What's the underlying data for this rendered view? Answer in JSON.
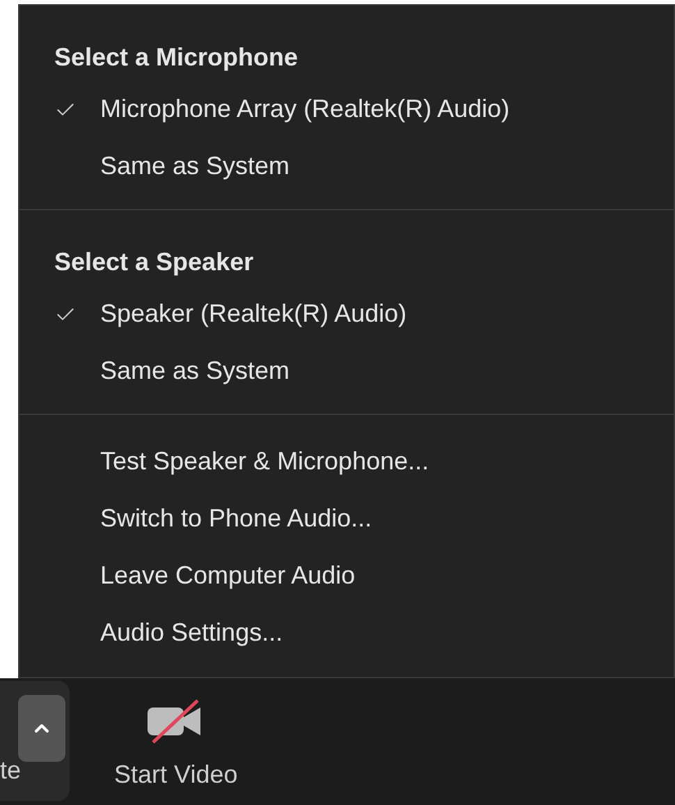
{
  "sections": [
    {
      "title": "Select a Microphone",
      "items": [
        {
          "label": "Microphone Array (Realtek(R) Audio)",
          "selected": true
        },
        {
          "label": "Same as System",
          "selected": false
        }
      ]
    },
    {
      "title": "Select a Speaker",
      "items": [
        {
          "label": "Speaker (Realtek(R) Audio)",
          "selected": true
        },
        {
          "label": "Same as System",
          "selected": false
        }
      ]
    }
  ],
  "actions": [
    "Test Speaker & Microphone...",
    "Switch to Phone Audio...",
    "Leave Computer Audio",
    "Audio Settings..."
  ],
  "toolbar": {
    "cut_label": "te",
    "video_button": {
      "label": "Start Video",
      "on": false
    }
  }
}
